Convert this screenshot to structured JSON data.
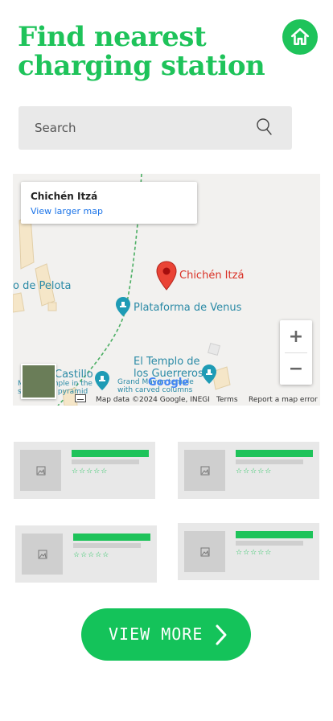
{
  "header": {
    "title_line1": "Find nearest",
    "title_line2": "charging station"
  },
  "search": {
    "placeholder": "Search"
  },
  "map": {
    "place_name": "Chichén Itzá",
    "larger_map_link": "View larger map",
    "labels": {
      "pelota": "o de Pelota",
      "pin_label": "Chichén Itzá",
      "venus": "Plataforma de Venus",
      "templo_line1": "El Templo de",
      "templo_line2": "los Guerreros",
      "castillo": "Castillo",
      "castillo_sub1": "Mayan temple in the",
      "castillo_sub2": "shape of a pyramid",
      "grand_sub1": "Grand Mayan temple",
      "grand_sub2": "with carved columns"
    },
    "google": "Google",
    "attribution": "Map data ©2024 Google, INEGI",
    "terms": "Terms",
    "report": "Report a map error",
    "zoom_in": "+",
    "zoom_out": "−"
  },
  "cards": [
    {
      "stars": "☆☆☆☆☆"
    },
    {
      "stars": "☆☆☆☆☆"
    },
    {
      "stars": "☆☆☆☆☆"
    },
    {
      "stars": "☆☆☆☆☆"
    }
  ],
  "cta": {
    "label": "VIEW MORE"
  },
  "colors": {
    "accent": "#1ec35a"
  }
}
